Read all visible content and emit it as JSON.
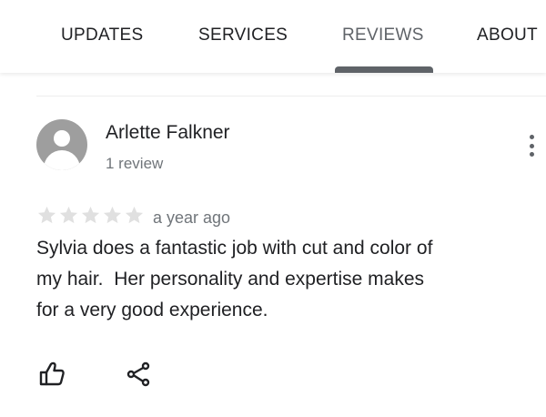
{
  "tabs": [
    {
      "label": "UPDATES",
      "active": false
    },
    {
      "label": "SERVICES",
      "active": false
    },
    {
      "label": "REVIEWS",
      "active": true
    },
    {
      "label": "ABOUT",
      "active": false
    }
  ],
  "review": {
    "reviewer_name": "Arlette Falkner",
    "review_count": "1 review",
    "rating": 0,
    "max_rating": 5,
    "date": "a year ago",
    "text": "Sylvia does a fantastic job with cut and color of\nmy hair.  Her personality and expertise makes\nfor a very good experience."
  },
  "icons": {
    "avatar": "default-avatar-icon",
    "more": "more-vert-icon",
    "like": "thumbs-up-icon",
    "share": "share-icon"
  },
  "colors": {
    "text_primary": "#202124",
    "text_secondary": "#70757a",
    "accent": "#5f6368",
    "star_empty": "#e0e0e0"
  }
}
